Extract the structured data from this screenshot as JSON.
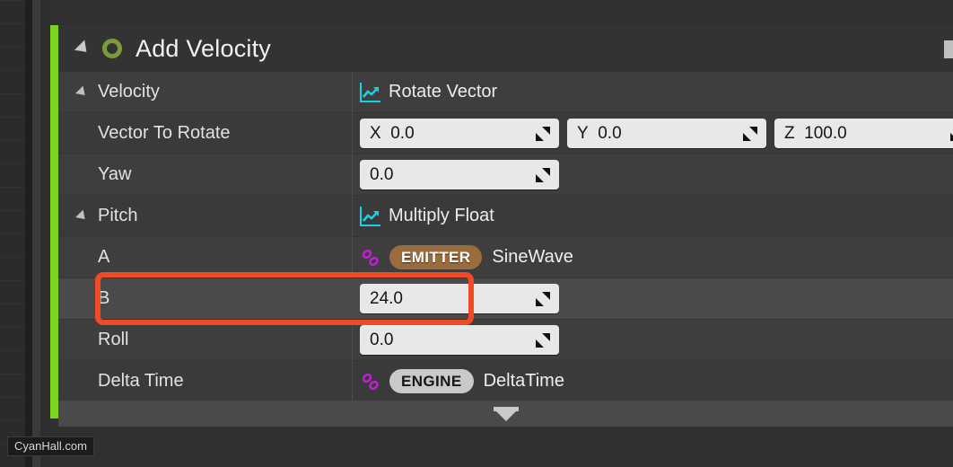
{
  "module": {
    "title": "Add Velocity",
    "expander_icon": "triangle-collapse-icon",
    "status_icon": "green-ring-icon",
    "edge_icon": "panel-edge-icon"
  },
  "rows": [
    {
      "id": "velocity",
      "label": "Velocity",
      "indent": "ind-1",
      "has_tri": true,
      "kind": "function",
      "func": "Rotate Vector",
      "func_icon": "line-chart-icon"
    },
    {
      "id": "vector-to-rotate",
      "label": "Vector To Rotate",
      "indent": "ind-2",
      "has_tri": false,
      "kind": "vector3",
      "fields": [
        {
          "axis": "X",
          "value": "0.0"
        },
        {
          "axis": "Y",
          "value": "0.0"
        },
        {
          "axis": "Z",
          "value": "100.0"
        }
      ]
    },
    {
      "id": "yaw",
      "label": "Yaw",
      "indent": "ind-2",
      "has_tri": false,
      "kind": "number",
      "value": "0.0"
    },
    {
      "id": "pitch",
      "label": "Pitch",
      "indent": "ind-3",
      "has_tri": true,
      "kind": "function",
      "func": "Multiply Float",
      "func_icon": "line-chart-icon"
    },
    {
      "id": "a",
      "label": "A",
      "indent": "ind-4",
      "has_tri": false,
      "kind": "pin",
      "pin_icon": "link-chain-icon",
      "badge": "EMITTER",
      "badge_style": "emitter",
      "pin_name": "SineWave"
    },
    {
      "id": "b",
      "label": "B",
      "indent": "ind-4",
      "has_tri": false,
      "kind": "number",
      "value": "24.0",
      "selected": true,
      "highlighted": true
    },
    {
      "id": "roll",
      "label": "Roll",
      "indent": "ind-2",
      "has_tri": false,
      "kind": "number",
      "value": "0.0"
    },
    {
      "id": "delta-time",
      "label": "Delta Time",
      "indent": "ind-2",
      "has_tri": false,
      "kind": "pin",
      "pin_icon": "link-chain-icon",
      "badge": "ENGINE",
      "badge_style": "engine",
      "pin_name": "DeltaTime"
    }
  ],
  "footer": {
    "expander_icon": "expand-down-icon"
  },
  "watermark": {
    "text": "CyanHall.com"
  },
  "colors": {
    "accent_green": "#7ed321",
    "annotation_red": "#f04a26",
    "chart_cyan": "#12d3e8",
    "pin_magenta": "#c91ae0",
    "emitter_badge": "#9a6b3c",
    "engine_badge": "#c9c9c9",
    "panel_bg": "#3e3e3e",
    "header_bg": "#333333"
  }
}
